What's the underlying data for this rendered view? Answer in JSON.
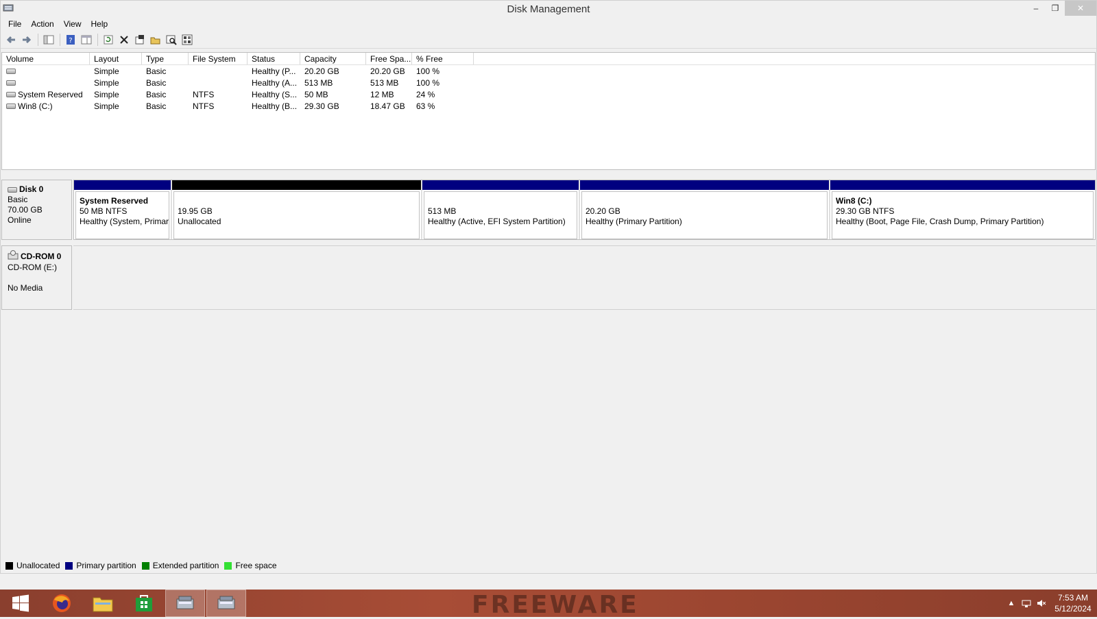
{
  "window": {
    "title": "Disk Management",
    "controls": {
      "minimize": "–",
      "restore": "❐",
      "close": "✕"
    }
  },
  "menu": [
    "File",
    "Action",
    "View",
    "Help"
  ],
  "toolbar_icons": [
    "back-icon",
    "forward-icon",
    "show-hide-console-tree-icon",
    "help-icon",
    "properties-pane-icon",
    "refresh-icon",
    "delete-icon",
    "properties-icon",
    "open-icon",
    "explore-icon",
    "settings-icon"
  ],
  "volume_list": {
    "columns": [
      "Volume",
      "Layout",
      "Type",
      "File System",
      "Status",
      "Capacity",
      "Free Spa...",
      "% Free"
    ],
    "rows": [
      {
        "volume": "",
        "layout": "Simple",
        "type": "Basic",
        "fs": "",
        "status": "Healthy (P...",
        "capacity": "20.20 GB",
        "free": "20.20 GB",
        "pct": "100 %"
      },
      {
        "volume": "",
        "layout": "Simple",
        "type": "Basic",
        "fs": "",
        "status": "Healthy (A...",
        "capacity": "513 MB",
        "free": "513 MB",
        "pct": "100 %"
      },
      {
        "volume": "System Reserved",
        "layout": "Simple",
        "type": "Basic",
        "fs": "NTFS",
        "status": "Healthy (S...",
        "capacity": "50 MB",
        "free": "12 MB",
        "pct": "24 %"
      },
      {
        "volume": "Win8 (C:)",
        "layout": "Simple",
        "type": "Basic",
        "fs": "NTFS",
        "status": "Healthy (B...",
        "capacity": "29.30 GB",
        "free": "18.47 GB",
        "pct": "63 %"
      }
    ]
  },
  "disks": {
    "disk0": {
      "name": "Disk 0",
      "type": "Basic",
      "size": "70.00 GB",
      "status": "Online",
      "partitions": [
        {
          "title": "System Reserved",
          "line1": "50 MB NTFS",
          "line2": "Healthy (System, Primar"
        },
        {
          "title": "",
          "line1": "19.95 GB",
          "line2": "Unallocated"
        },
        {
          "title": "",
          "line1": "513 MB",
          "line2": "Healthy (Active, EFI System Partition)"
        },
        {
          "title": "",
          "line1": "20.20 GB",
          "line2": "Healthy (Primary Partition)"
        },
        {
          "title": "Win8  (C:)",
          "line1": "29.30 GB NTFS",
          "line2": "Healthy (Boot, Page File, Crash Dump, Primary Partition)"
        }
      ]
    },
    "cdrom0": {
      "name": "CD-ROM 0",
      "drive": "CD-ROM (E:)",
      "status": "No Media"
    }
  },
  "legend": [
    {
      "label": "Unallocated",
      "color": "#000000"
    },
    {
      "label": "Primary partition",
      "color": "#000080"
    },
    {
      "label": "Extended partition",
      "color": "#008000"
    },
    {
      "label": "Free space",
      "color": "#33e033"
    }
  ],
  "taskbar": {
    "watermark": "FREEWARE",
    "clock_time": "7:53 AM",
    "clock_date": "5/12/2024"
  },
  "colors": {
    "primary_partition": "#000080",
    "unallocated": "#000000",
    "taskbar": "#9a4530"
  }
}
